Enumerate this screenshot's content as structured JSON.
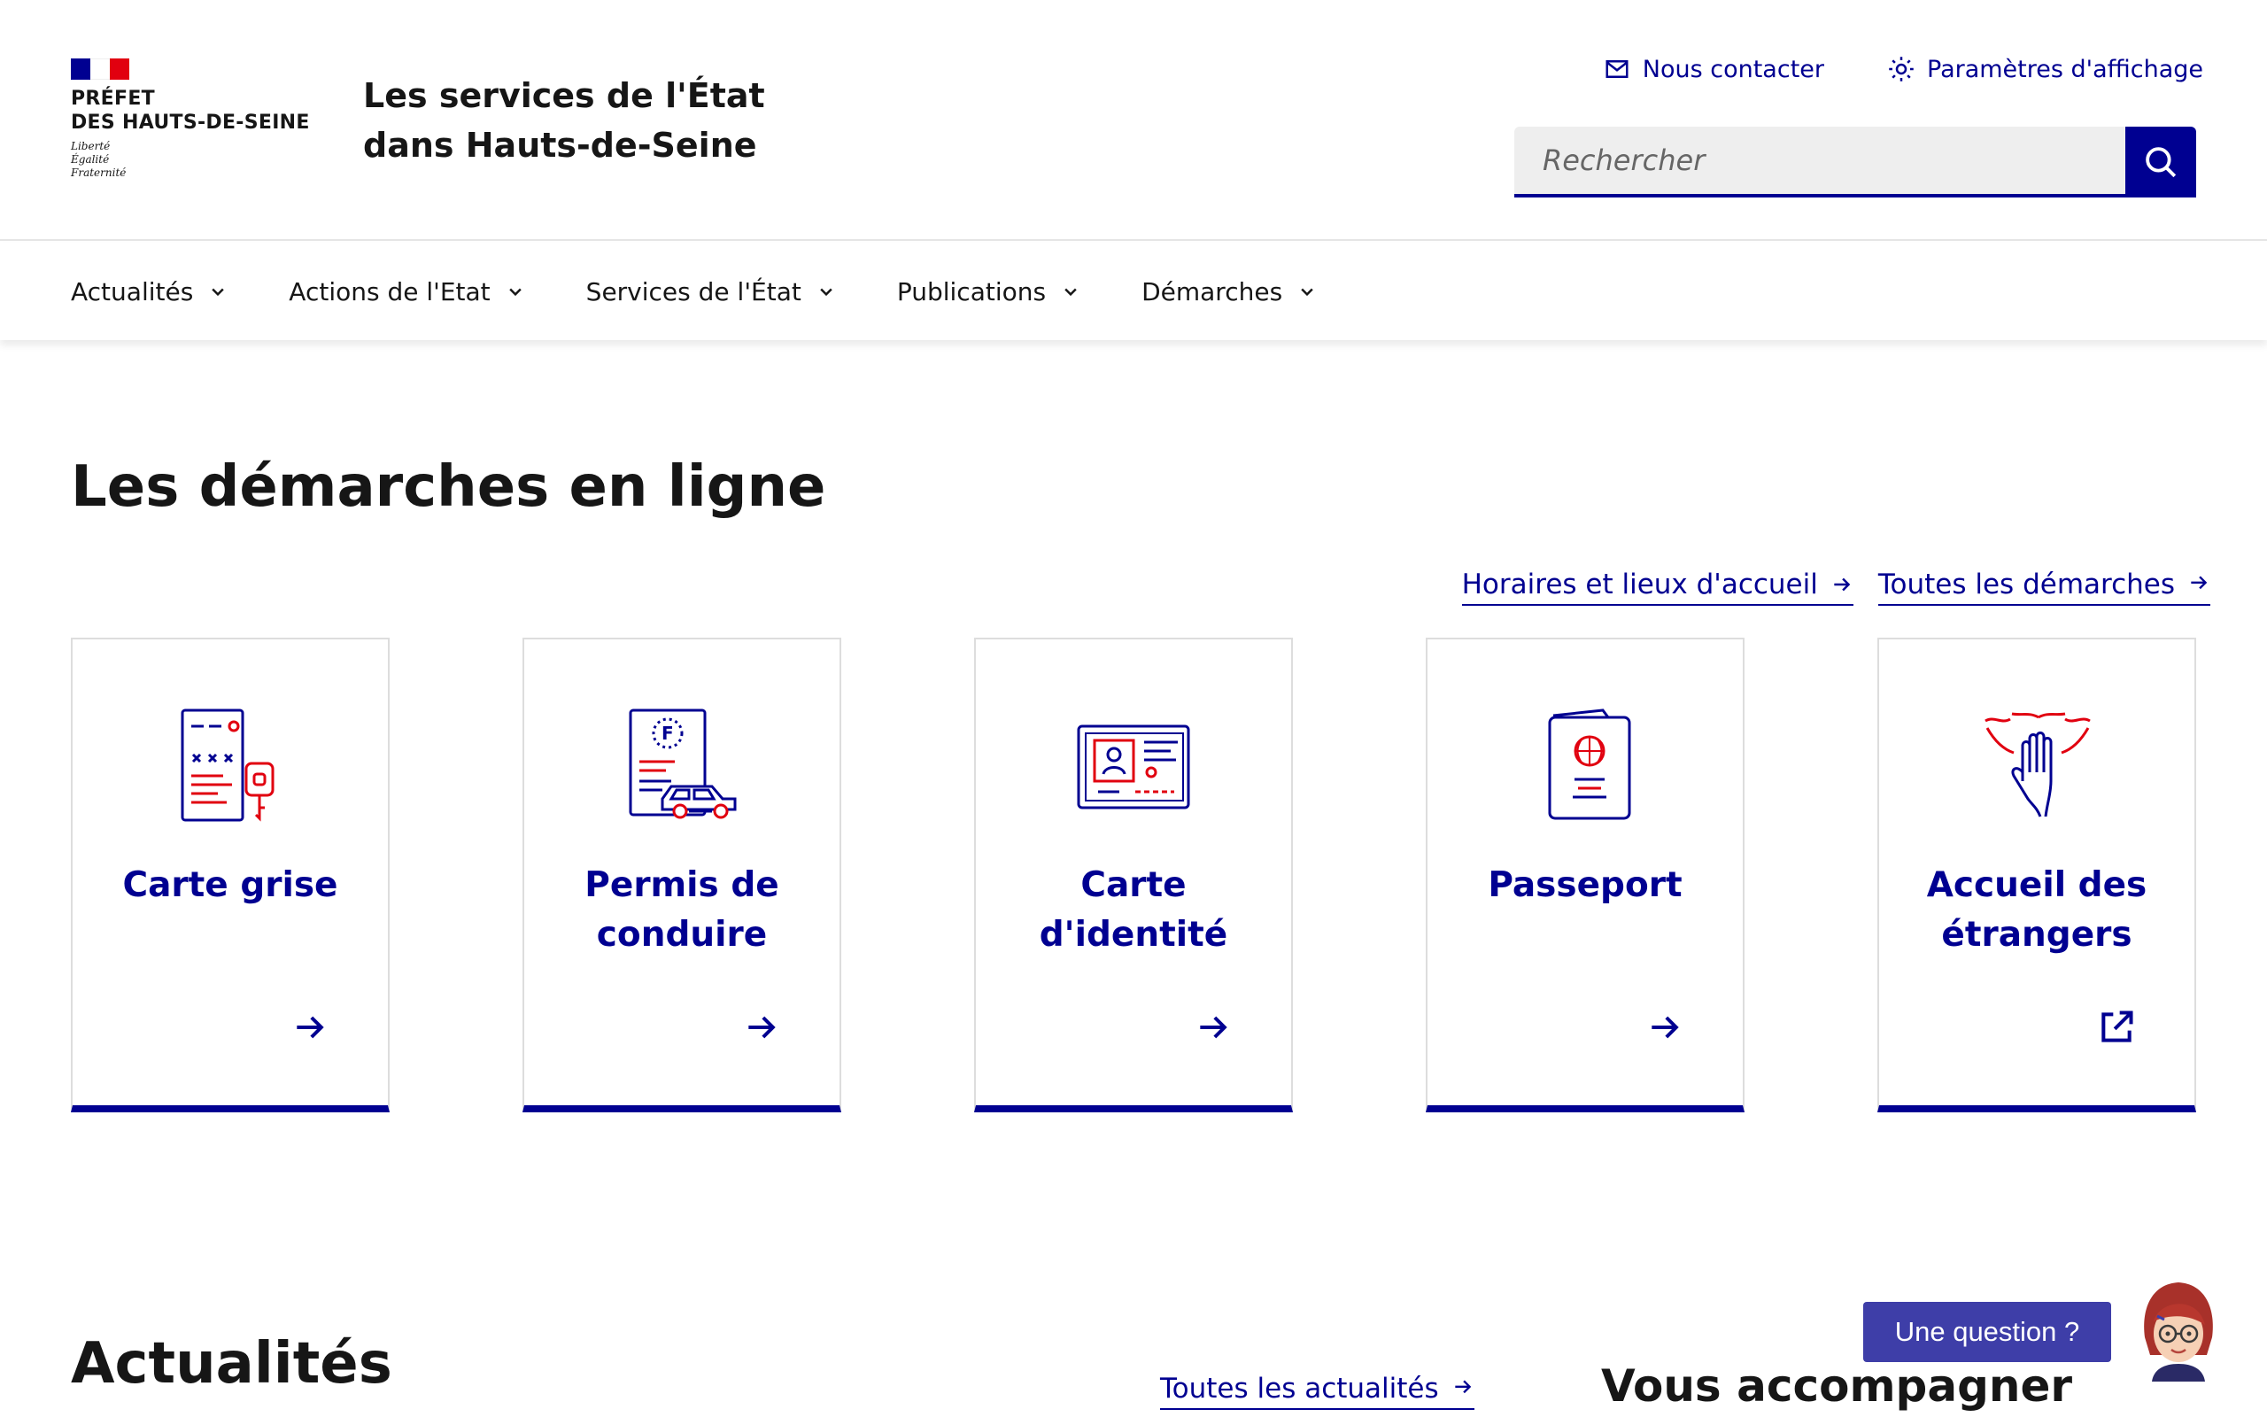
{
  "header": {
    "logo_title": "PRÉFET\nDES HAUTS-DE-SEINE",
    "motto": "Liberté\nÉgalité\nFraternité",
    "service_title": "Les services de l'État dans Hauts-de-Seine",
    "quick_links": {
      "contact": "Nous contacter",
      "display_settings": "Paramètres d'affichage"
    },
    "search": {
      "placeholder": "Rechercher"
    }
  },
  "nav": {
    "items": [
      {
        "label": "Actualités"
      },
      {
        "label": "Actions de l'Etat"
      },
      {
        "label": "Services de l'État"
      },
      {
        "label": "Publications"
      },
      {
        "label": "Démarches"
      }
    ]
  },
  "demarches": {
    "title": "Les démarches en ligne",
    "links": {
      "horaires": "Horaires et lieux d'accueil",
      "toutes": "Toutes les démarches"
    },
    "cards": [
      {
        "title": "Carte grise",
        "icon": "car-registration-icon",
        "arrow": "arrow-right-icon"
      },
      {
        "title": "Permis de conduire",
        "icon": "driving-license-icon",
        "arrow": "arrow-right-icon"
      },
      {
        "title": "Carte d'identité",
        "icon": "id-card-icon",
        "arrow": "arrow-right-icon"
      },
      {
        "title": "Passeport",
        "icon": "passport-icon",
        "arrow": "arrow-right-icon"
      },
      {
        "title": "Accueil des étrangers",
        "icon": "welcome-hands-icon",
        "arrow": "external-link-icon"
      }
    ]
  },
  "actualites": {
    "title": "Actualités",
    "link": "Toutes les actualités"
  },
  "accompagner": {
    "title": "Vous accompagner"
  },
  "chat": {
    "label": "Une question ?"
  },
  "colors": {
    "primary": "#000091",
    "accent_red": "#e1000f",
    "chat": "#3e3ea8",
    "search_bg": "#eeeeee"
  }
}
